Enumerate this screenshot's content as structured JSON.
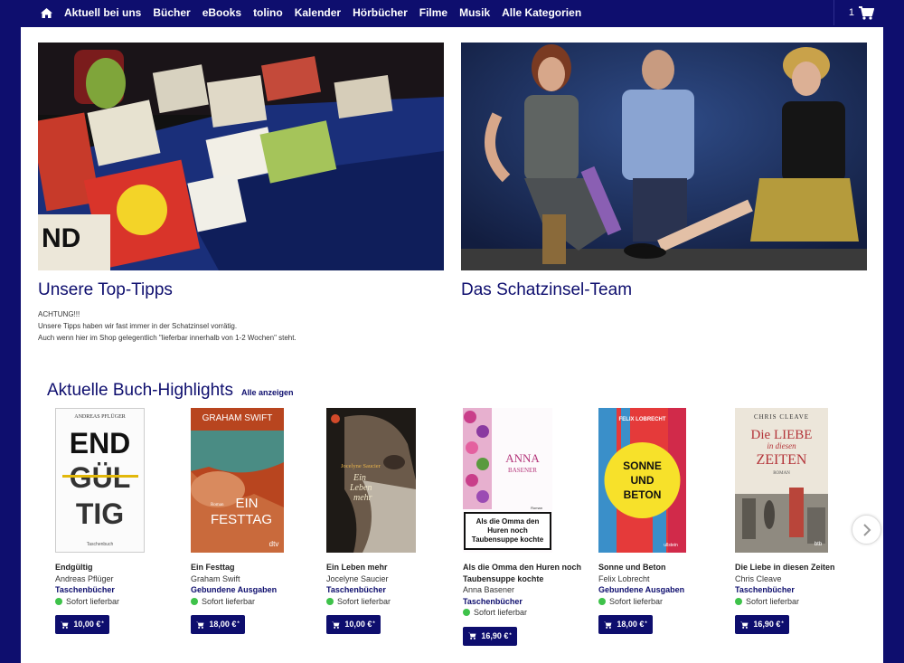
{
  "nav": {
    "items": [
      "Aktuell bei uns",
      "Bücher",
      "eBooks",
      "tolino",
      "Kalender",
      "Hörbücher",
      "Filme",
      "Musik",
      "Alle Kategorien"
    ],
    "cart_count": "1"
  },
  "features": [
    {
      "title": "Unsere Top-Tipps",
      "lines": [
        "ACHTUNG!!!",
        "Unsere Tipps haben wir fast immer in der Schatzinsel vorrätig.",
        "Auch wenn hier im Shop gelegentlich \"lieferbar innerhalb von 1-2 Wochen\" steht."
      ]
    },
    {
      "title": "Das Schatzinsel-Team",
      "lines": []
    }
  ],
  "highlights": {
    "title": "Aktuelle Buch-Highlights",
    "link": "Alle anzeigen"
  },
  "books": [
    {
      "title": "Endgültig",
      "author": "Andreas Pflüger",
      "format": "Taschenbücher",
      "availability": "Sofort lieferbar",
      "price": "10,00 €",
      "price_mark": "*",
      "cover": {
        "top": "ANDREAS PFLÜGER",
        "main": [
          "END",
          "GÜL",
          "TIG"
        ],
        "bottom": "Taschenbuch"
      }
    },
    {
      "title": "Ein Festtag",
      "author": "Graham Swift",
      "format": "Gebundene Ausgaben",
      "availability": "Sofort lieferbar",
      "price": "18,00 €",
      "price_mark": "*",
      "cover": {
        "top": "GRAHAM SWIFT",
        "main": [
          "EIN",
          "FESTTAG"
        ],
        "small": "Roman",
        "bottom": "dtv"
      }
    },
    {
      "title": "Ein Leben mehr",
      "author": "Jocelyne Saucier",
      "format": "Taschenbücher",
      "availability": "Sofort lieferbar",
      "price": "10,00 €",
      "price_mark": "*",
      "cover": {
        "top": "Jocelyne Saucier",
        "main": [
          "Ein",
          "Leben",
          "mehr"
        ]
      }
    },
    {
      "title": "Als die Omma den Huren noch Taubensuppe kochte",
      "author": "Anna Basener",
      "format": "Taschenbücher",
      "availability": "Sofort lieferbar",
      "price": "16,90 €",
      "price_mark": "*",
      "cover": {
        "top": "ANNA",
        "sub": "BASENER",
        "small": "Roman",
        "main": [
          "Als die Omma den",
          "Huren noch",
          "Taubensuppe kochte"
        ]
      }
    },
    {
      "title": "Sonne und Beton",
      "author": "Felix Lobrecht",
      "format": "Gebundene Ausgaben",
      "availability": "Sofort lieferbar",
      "price": "18,00 €",
      "price_mark": "*",
      "cover": {
        "top": "FELIX LOBRECHT",
        "main": [
          "SONNE",
          "UND",
          "BETON"
        ],
        "bottom": "ullstein"
      }
    },
    {
      "title": "Die Liebe in diesen Zeiten",
      "author": "Chris Cleave",
      "format": "Taschenbücher",
      "availability": "Sofort lieferbar",
      "price": "16,90 €",
      "price_mark": "*",
      "cover": {
        "top": "CHRIS CLEAVE",
        "main": [
          "Die LIEBE",
          "in diesen",
          "ZEITEN"
        ],
        "small": "ROMAN",
        "bottom": "btb"
      }
    }
  ],
  "colors": {
    "brand": "#0e0e6e",
    "available": "#3ec24a"
  }
}
